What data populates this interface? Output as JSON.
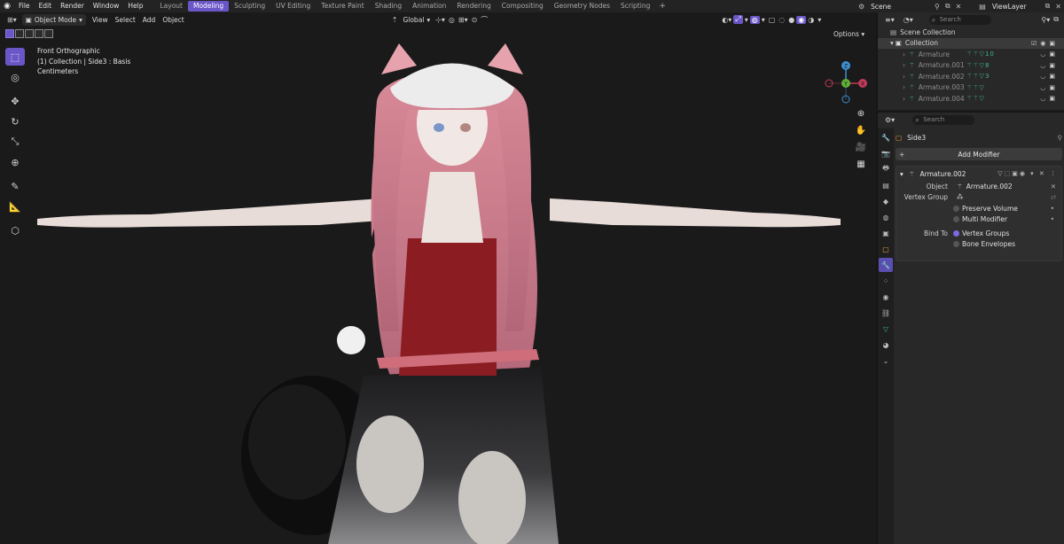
{
  "topbar": {
    "menus": [
      "File",
      "Edit",
      "Render",
      "Window",
      "Help"
    ],
    "workspaces": [
      "Layout",
      "Modeling",
      "Sculpting",
      "UV Editing",
      "Texture Paint",
      "Shading",
      "Animation",
      "Rendering",
      "Compositing",
      "Geometry Nodes",
      "Scripting"
    ],
    "active_workspace": "Modeling",
    "scene": "Scene",
    "view_layer": "ViewLayer"
  },
  "viewport": {
    "mode": "Object Mode",
    "menus": [
      "View",
      "Select",
      "Add",
      "Object"
    ],
    "transform_orientation": "Global",
    "options_label": "Options",
    "info": {
      "view_name": "Front Orthographic",
      "context": "(1) Collection | Side3 : Basis",
      "units": "Centimeters"
    },
    "gizmo_axes": [
      "Z",
      "Y",
      "X"
    ]
  },
  "outliner": {
    "search_placeholder": "Search",
    "scene_collection": "Scene Collection",
    "collection": "Collection",
    "items": [
      {
        "name": "Armature",
        "count": "10"
      },
      {
        "name": "Armature.001",
        "count": "8"
      },
      {
        "name": "Armature.002",
        "count": "3"
      },
      {
        "name": "Armature.003",
        "count": ""
      },
      {
        "name": "Armature.004",
        "count": ""
      }
    ]
  },
  "properties": {
    "search_placeholder": "Search",
    "object_name": "Side3",
    "add_modifier_label": "Add Modifier",
    "modifier": {
      "name": "Armature.002",
      "object_label": "Object",
      "object_value": "Armature.002",
      "vertex_group_label": "Vertex Group",
      "preserve_volume": "Preserve Volume",
      "multi_modifier": "Multi Modifier",
      "bind_to_label": "Bind To",
      "vertex_groups": "Vertex Groups",
      "bone_envelopes": "Bone Envelopes"
    }
  },
  "colors": {
    "accent": "#6b56c8",
    "background": "#1a1a1a",
    "panel": "#282828",
    "modifier_green": "#3fb58a"
  }
}
